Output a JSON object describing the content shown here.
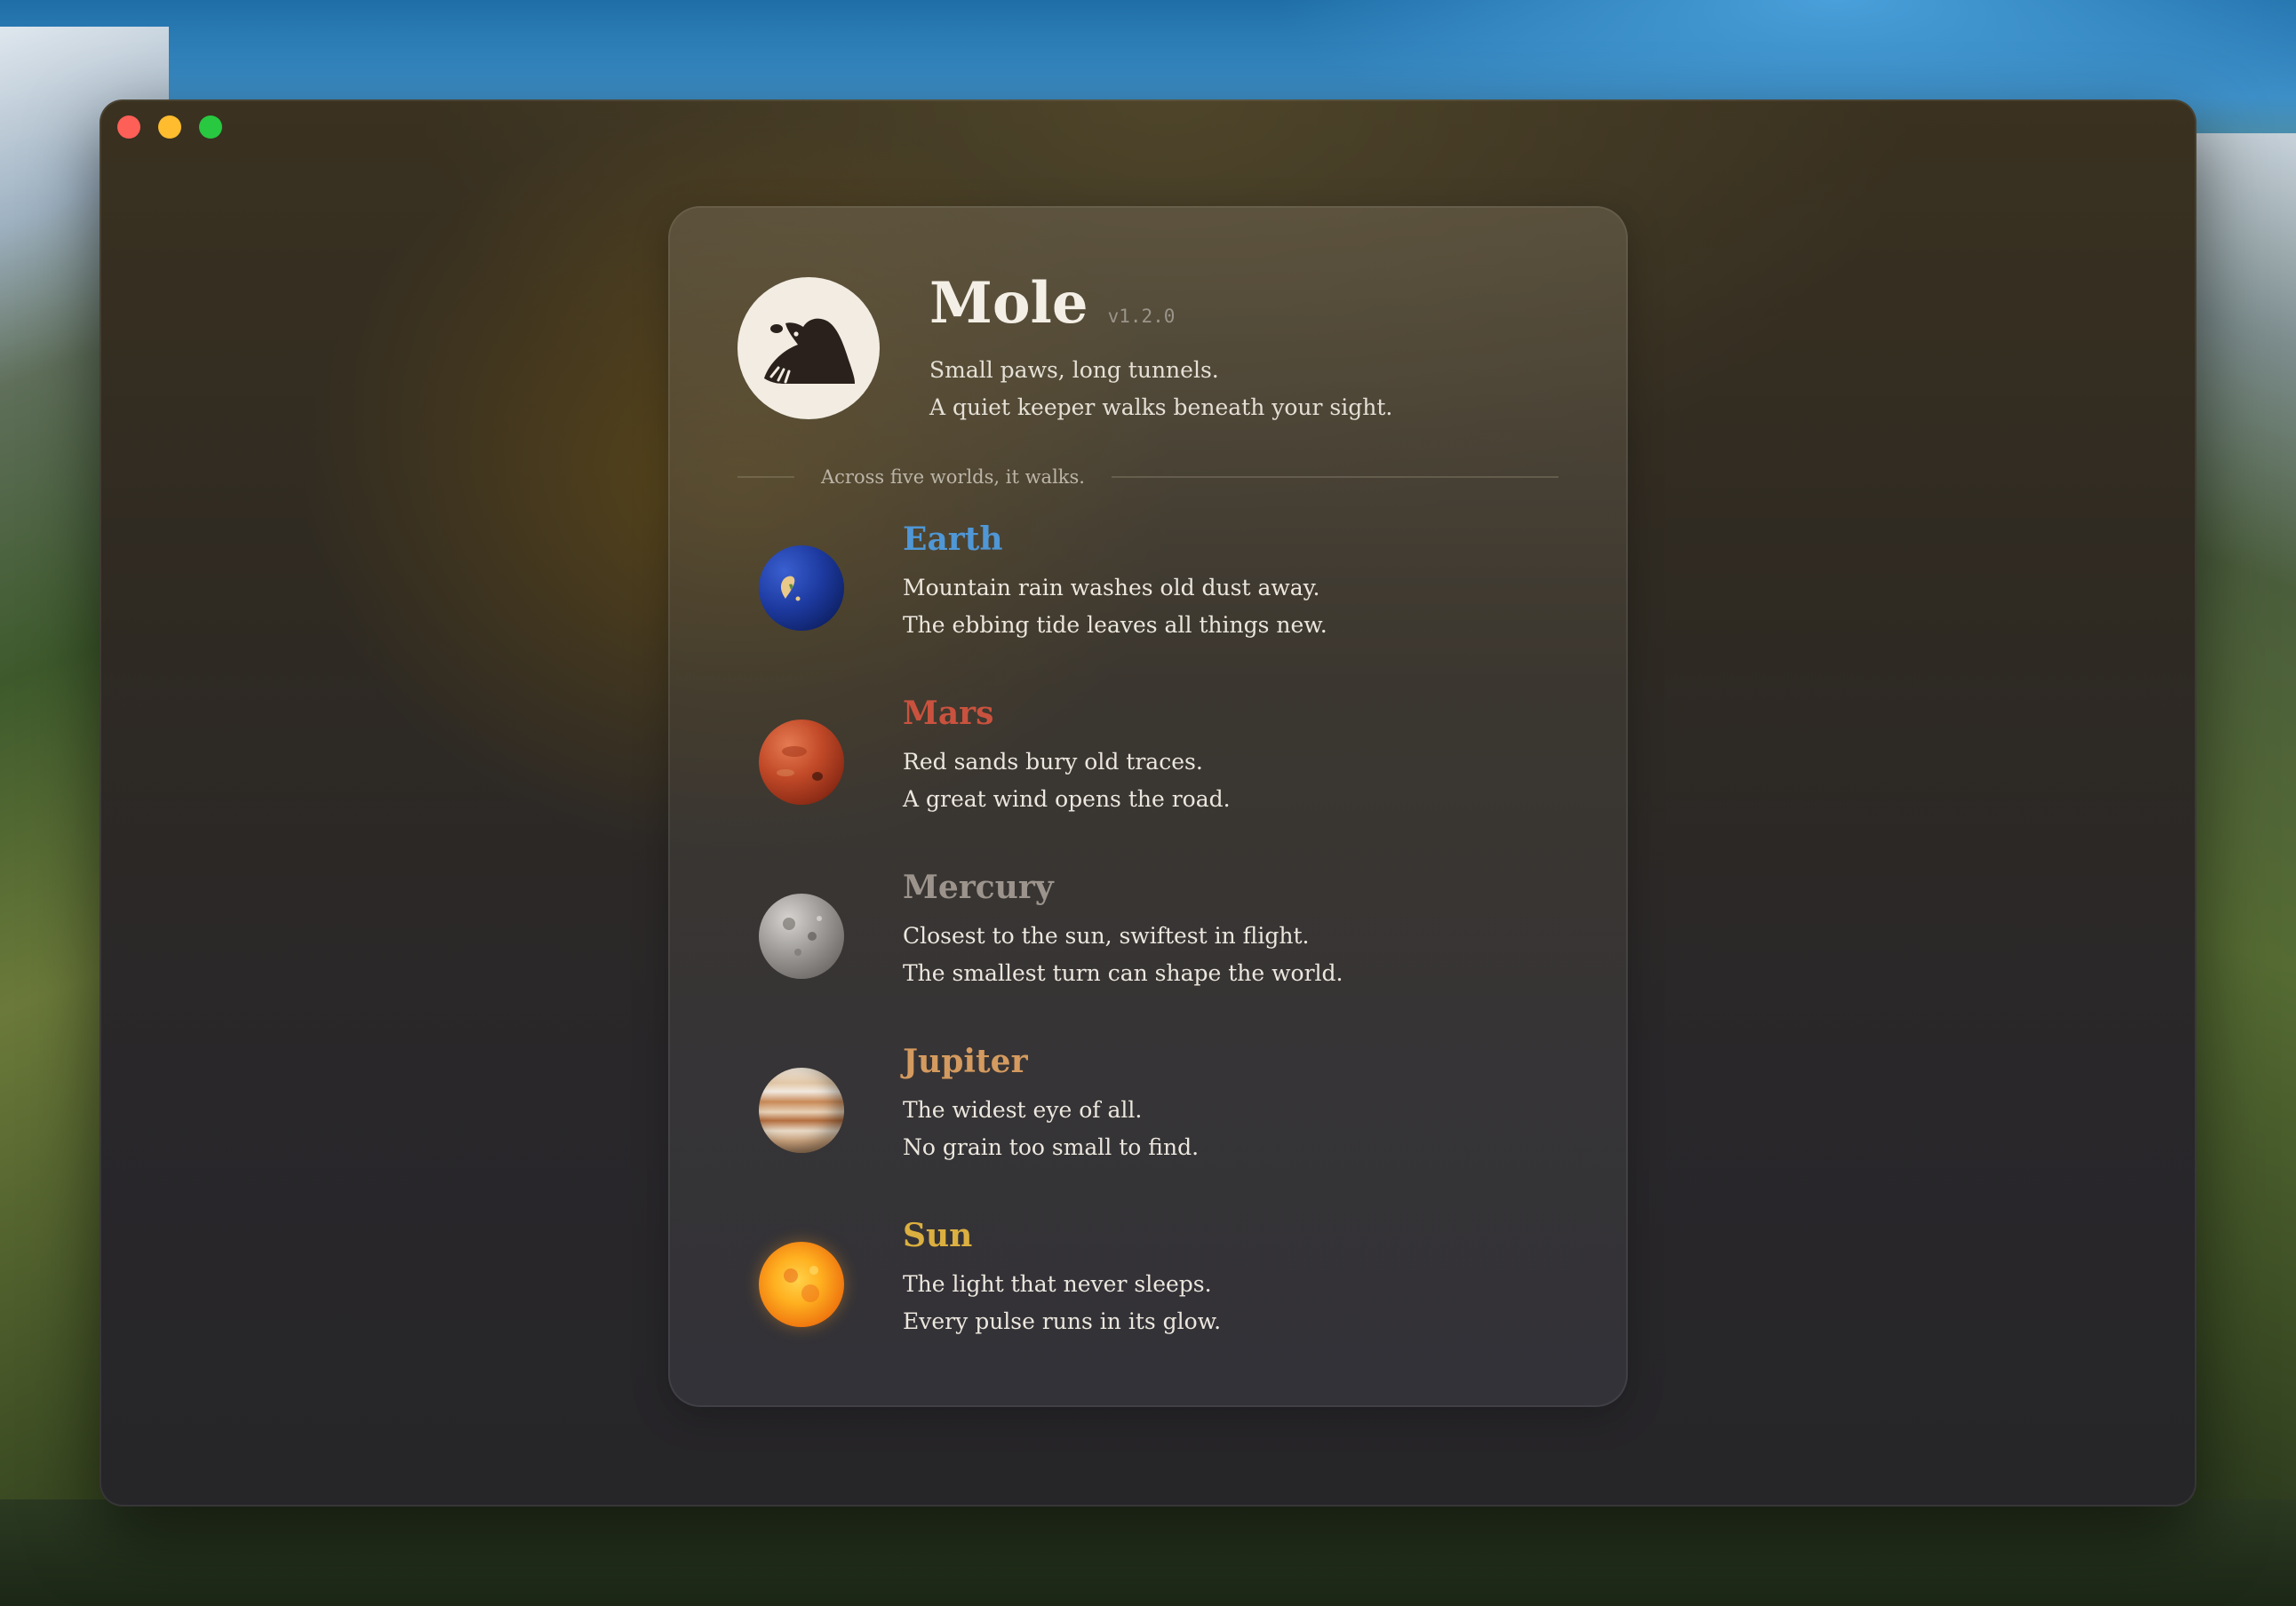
{
  "window": {
    "controls": [
      "close",
      "minimize",
      "zoom"
    ]
  },
  "app": {
    "name": "Mole",
    "version": "v1.2.0",
    "tagline_1": "Small paws, long tunnels.",
    "tagline_2": "A quiet keeper walks beneath your sight.",
    "logo_icon": "mole-icon"
  },
  "divider": {
    "text": "Across five worlds, it walks."
  },
  "worlds": [
    {
      "name": "Earth",
      "color": "#4f97d6",
      "icon": "earth-planet-icon",
      "line1": "Mountain rain washes old dust away.",
      "line2": "The ebbing tide leaves all things new."
    },
    {
      "name": "Mars",
      "color": "#c9523e",
      "icon": "mars-planet-icon",
      "line1": "Red sands bury old traces.",
      "line2": "A great wind opens the road."
    },
    {
      "name": "Mercury",
      "color": "#9c948c",
      "icon": "mercury-planet-icon",
      "line1": "Closest to the sun, swiftest in flight.",
      "line2": "The smallest turn can shape the world."
    },
    {
      "name": "Jupiter",
      "color": "#d49a5f",
      "icon": "jupiter-planet-icon",
      "line1": "The widest eye of all.",
      "line2": "No grain too small to find."
    },
    {
      "name": "Sun",
      "color": "#dcb040",
      "icon": "sun-icon",
      "line1": "The light that never sleeps.",
      "line2": "Every pulse runs in its glow."
    }
  ]
}
